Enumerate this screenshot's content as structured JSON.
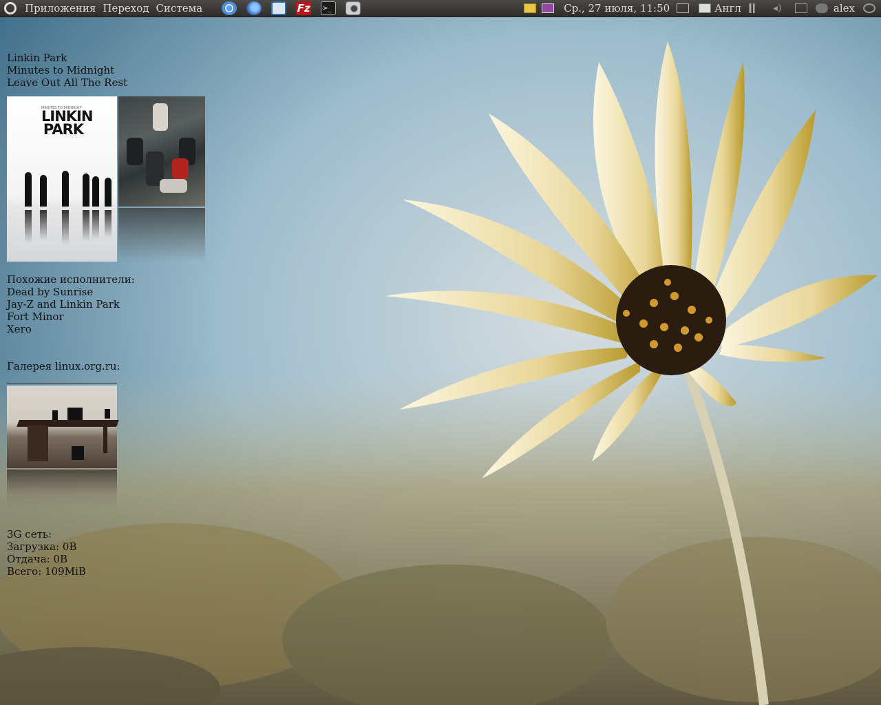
{
  "panel": {
    "menu": [
      "Приложения",
      "Переход",
      "Система"
    ],
    "launchers": [
      {
        "name": "chrome-icon"
      },
      {
        "name": "thunderbird-icon"
      },
      {
        "name": "system-monitor-icon"
      },
      {
        "name": "filezilla-icon",
        "label": "Fz"
      },
      {
        "name": "terminal-icon",
        "label": ">_"
      },
      {
        "name": "screenshot-camera-icon"
      }
    ],
    "clock": "Ср., 27 июля, 11:50",
    "keyboard_layout": "Англ",
    "user": "alex"
  },
  "conky": {
    "now_playing": {
      "artist": "Linkin Park",
      "album": "Minutes to Midnight",
      "track": "Leave Out All The Rest"
    },
    "cover": {
      "brand": "LINKIN PARK",
      "tiny": "MINUTES TO MIDNIGHT"
    },
    "similar": {
      "title": "Похожие исполнители:",
      "items": [
        "Dead by Sunrise",
        "Jay-Z and Linkin Park",
        "Fort Minor",
        "Xero"
      ]
    },
    "gallery": {
      "title": "Галерея linux.org.ru:"
    },
    "network": {
      "title": "3G сеть:",
      "download": "Загрузка: 0B",
      "upload": "Отдача: 0B",
      "total": "Всего: 109MiB"
    }
  },
  "colors": {
    "panel_bg": "#3a3935",
    "panel_text": "#dfdbd2",
    "conky_text": "#111111",
    "filezilla_red": "#b8141a"
  }
}
